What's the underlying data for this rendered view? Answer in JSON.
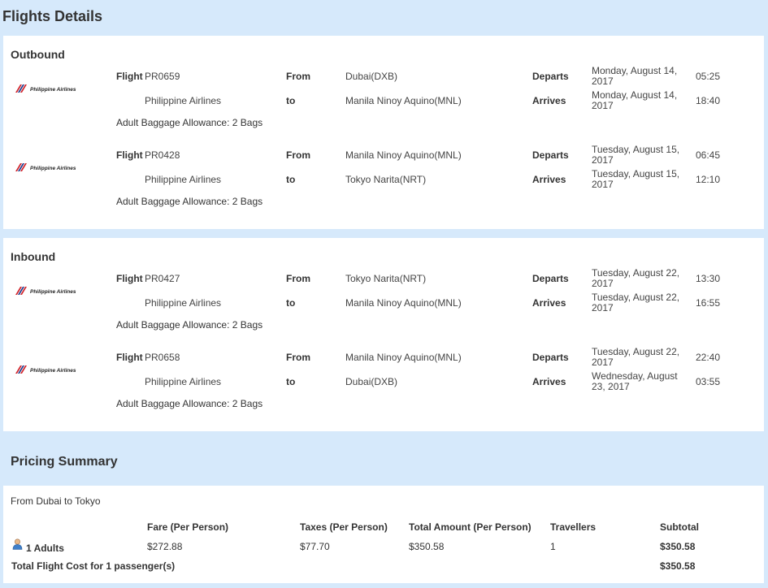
{
  "page_title": "Flights Details",
  "outbound": {
    "title": "Outbound",
    "segments": [
      {
        "airline_logo": "Philippine Airlines",
        "flight_label": "Flight",
        "flight_number": "PR0659",
        "airline": "Philippine Airlines",
        "from_label": "From",
        "from": "Dubai(DXB)",
        "to_label": "to",
        "to": "Manila Ninoy Aquino(MNL)",
        "departs_label": "Departs",
        "depart_date": "Monday, August 14, 2017",
        "depart_time": "05:25",
        "arrives_label": "Arrives",
        "arrive_date": "Monday, August 14, 2017",
        "arrive_time": "18:40",
        "baggage": "Adult Baggage Allowance: 2 Bags"
      },
      {
        "airline_logo": "Philippine Airlines",
        "flight_label": "Flight",
        "flight_number": "PR0428",
        "airline": "Philippine Airlines",
        "from_label": "From",
        "from": "Manila Ninoy Aquino(MNL)",
        "to_label": "to",
        "to": "Tokyo Narita(NRT)",
        "departs_label": "Departs",
        "depart_date": "Tuesday, August 15, 2017",
        "depart_time": "06:45",
        "arrives_label": "Arrives",
        "arrive_date": "Tuesday, August 15, 2017",
        "arrive_time": "12:10",
        "baggage": "Adult Baggage Allowance: 2 Bags"
      }
    ]
  },
  "inbound": {
    "title": "Inbound",
    "segments": [
      {
        "airline_logo": "Philippine Airlines",
        "flight_label": "Flight",
        "flight_number": "PR0427",
        "airline": "Philippine Airlines",
        "from_label": "From",
        "from": "Tokyo Narita(NRT)",
        "to_label": "to",
        "to": "Manila Ninoy Aquino(MNL)",
        "departs_label": "Departs",
        "depart_date": "Tuesday, August 22, 2017",
        "depart_time": "13:30",
        "arrives_label": "Arrives",
        "arrive_date": "Tuesday, August 22, 2017",
        "arrive_time": "16:55",
        "baggage": "Adult Baggage Allowance: 2 Bags"
      },
      {
        "airline_logo": "Philippine Airlines",
        "flight_label": "Flight",
        "flight_number": "PR0658",
        "airline": "Philippine Airlines",
        "from_label": "From",
        "from": "Manila Ninoy Aquino(MNL)",
        "to_label": "to",
        "to": "Dubai(DXB)",
        "departs_label": "Departs",
        "depart_date": "Tuesday, August 22, 2017",
        "depart_time": "22:40",
        "arrives_label": "Arrives",
        "arrive_date": "Wednesday, August 23, 2017",
        "arrive_time": "03:55",
        "baggage": "Adult Baggage Allowance: 2 Bags"
      }
    ]
  },
  "pricing": {
    "title": "Pricing Summary",
    "route": "From Dubai to Tokyo",
    "headers": {
      "fare": "Fare (Per Person)",
      "taxes": "Taxes (Per Person)",
      "total_amount": "Total Amount (Per Person)",
      "travellers": "Travellers",
      "subtotal": "Subtotal"
    },
    "row": {
      "passenger_icon": "user-icon",
      "passengers": "1 Adults",
      "fare": "$272.88",
      "taxes": "$77.70",
      "total_amount": "$350.58",
      "travellers": "1",
      "subtotal": "$350.58"
    },
    "total_label": "Total Flight Cost for 1 passenger(s)",
    "total_value": "$350.58"
  },
  "colors": {
    "background": "#d6e9fb",
    "panel": "#ffffff",
    "logo_red": "#d2232a",
    "logo_blue": "#1d3c8f"
  }
}
